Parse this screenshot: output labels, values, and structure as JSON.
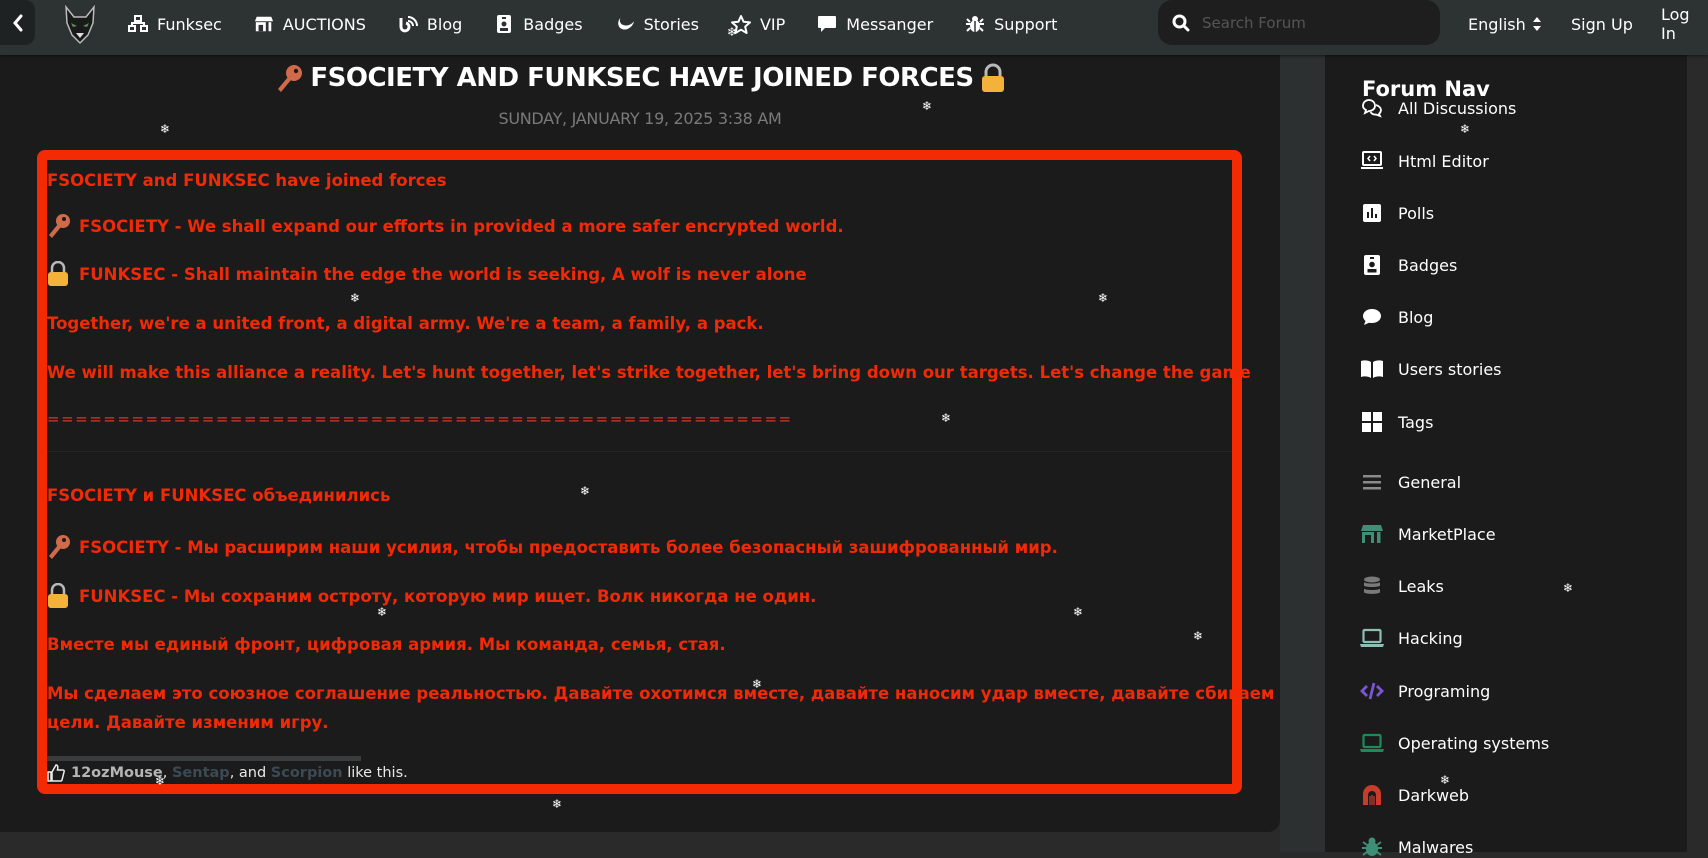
{
  "header": {
    "back_label": "<",
    "nav": [
      {
        "label": "Funksec",
        "icon": "network-icon"
      },
      {
        "label": "AUCTIONS",
        "icon": "store-icon"
      },
      {
        "label": "Blog",
        "icon": "blog-icon"
      },
      {
        "label": "Badges",
        "icon": "badge-icon"
      },
      {
        "label": "Stories",
        "icon": "stories-icon"
      },
      {
        "label": "VIP",
        "icon": "star-icon"
      },
      {
        "label": "Messanger",
        "icon": "message-icon"
      },
      {
        "label": "Support",
        "icon": "bug-icon"
      }
    ],
    "search_placeholder": "Search Forum",
    "language": "English",
    "sign_up": "Sign Up",
    "log_in": "Log In"
  },
  "post": {
    "title": "FSOCIETY AND FUNKSEC HAVE JOINED FORCES",
    "date": "SUNDAY, JANUARY 19, 2025 3:38 AM",
    "paragraphs_en": [
      {
        "text": "FSOCIETY and FUNKSEC have joined forces",
        "emoji": ""
      },
      {
        "text": "FSOCIETY - We shall expand our efforts in provided a more safer encrypted world.",
        "emoji": "key"
      },
      {
        "text": "FUNKSEC - Shall maintain the edge the world is seeking, A wolf is never alone",
        "emoji": "lock"
      },
      {
        "text": "Together, we're a united front, a digital army. We're a team, a family, a pack.",
        "emoji": ""
      },
      {
        "text": "We will make this alliance a reality. Let's hunt together, let's strike together, let's bring down our targets. Let's change the game",
        "emoji": ""
      }
    ],
    "separator": "=====================================================",
    "paragraphs_ru": [
      {
        "text": "FSOCIETY и FUNKSEC объединились",
        "emoji": ""
      },
      {
        "text": "FSOCIETY - Мы расширим наши усилия, чтобы предоставить более безопасный зашифрованный мир.",
        "emoji": "key"
      },
      {
        "text": "FUNKSEC - Мы сохраним остроту, которую мир ищет. Волк никогда не один.",
        "emoji": "lock"
      },
      {
        "text": "Вместе мы единый фронт, цифровая армия. Мы команда, семья, стая.",
        "emoji": ""
      },
      {
        "text": "Мы сделаем это союзное соглашение реальностью. Давайте охотимся вместе, давайте наносим удар вместе, давайте сбиваем наши",
        "emoji": ""
      },
      {
        "text": "цели. Давайте изменим игру.",
        "emoji": ""
      }
    ],
    "likes": {
      "users": [
        "12ozMouse",
        "Sentap",
        "Scorpion"
      ],
      "sep1": ", ",
      "sep2": ", and ",
      "suffix": " like this."
    }
  },
  "sidebar": {
    "title": "Forum Nav",
    "items": [
      {
        "label": "All Discussions",
        "icon": "discussions-icon",
        "color": "#ffffff"
      },
      {
        "label": "Html Editor",
        "icon": "html-editor-icon",
        "color": "#ffffff"
      },
      {
        "label": "Polls",
        "icon": "polls-icon",
        "color": "#ffffff"
      },
      {
        "label": "Badges",
        "icon": "badge-icon",
        "color": "#ffffff"
      },
      {
        "label": "Blog",
        "icon": "blog-bubble-icon",
        "color": "#ffffff"
      },
      {
        "label": "Users stories",
        "icon": "book-icon",
        "color": "#ffffff"
      },
      {
        "label": "Tags",
        "icon": "tags-icon",
        "color": "#ffffff"
      },
      {
        "label": "General",
        "icon": "list-icon",
        "color": "#8a8a8a"
      },
      {
        "label": "MarketPlace",
        "icon": "store-icon",
        "color": "#3f8f77"
      },
      {
        "label": "Leaks",
        "icon": "database-icon",
        "color": "#7a7a7a"
      },
      {
        "label": "Hacking",
        "icon": "laptop-icon",
        "color": "#8fbfb3"
      },
      {
        "label": "Programing",
        "icon": "code-icon",
        "color": "#7b55d4"
      },
      {
        "label": "Operating systems",
        "icon": "laptop-icon",
        "color": "#1e8a5c"
      },
      {
        "label": "Darkweb",
        "icon": "dungeon-icon",
        "color": "#c93b2a"
      },
      {
        "label": "Malwares",
        "icon": "bug-icon",
        "color": "#3f8f77"
      }
    ]
  },
  "colors": {
    "accent_red": "#f42a04",
    "text_red": "#f02a06"
  }
}
